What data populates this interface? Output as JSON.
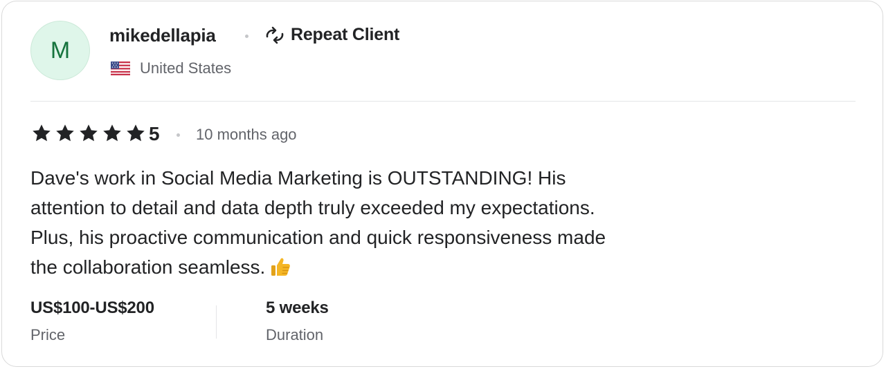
{
  "reviewer": {
    "avatar_initial": "M",
    "username": "mikedellapia",
    "badge_label": "Repeat Client",
    "country": "United States"
  },
  "rating": {
    "stars": 5,
    "value": "5",
    "time_ago": "10 months ago"
  },
  "review": {
    "text": "Dave's work in Social Media Marketing is OUTSTANDING! His attention to detail and data depth truly exceeded my expectations. Plus, his proactive communication and quick responsiveness made the collaboration seamless."
  },
  "meta": {
    "price_value": "US$100-US$200",
    "price_label": "Price",
    "duration_value": "5 weeks",
    "duration_label": "Duration"
  },
  "icons": {
    "repeat": "repeat-icon",
    "flag": "us-flag-icon",
    "star": "star-icon",
    "thumbs_up": "thumbs-up-icon"
  },
  "colors": {
    "avatar_bg": "#dff6ea",
    "avatar_text": "#15733d",
    "primary_text": "#222325",
    "secondary_text": "#62646a",
    "thumb": "#f5b625"
  }
}
